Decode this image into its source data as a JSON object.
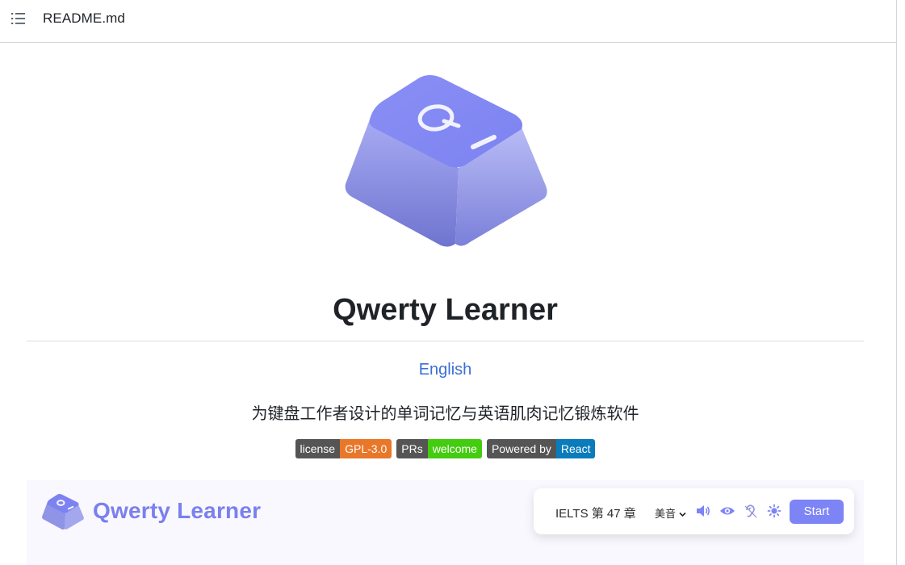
{
  "header": {
    "filename": "README.md",
    "toc_icon": "list-icon"
  },
  "readme": {
    "logo_icon": "keycap-q-logo",
    "title": "Qwerty Learner",
    "language_link": "English",
    "subtitle": "为键盘工作者设计的单词记忆与英语肌肉记忆锻炼软件",
    "badges": [
      {
        "label": "license",
        "value": "GPL-3.0",
        "color": "#e9772a"
      },
      {
        "label": "PRs",
        "value": "welcome",
        "color": "#44cc11"
      },
      {
        "label": "Powered by",
        "value": "React",
        "color": "#0a7bbb"
      }
    ]
  },
  "app_preview": {
    "app_name": "Qwerty Learner",
    "chapter_text": "IELTS 第 47 章",
    "accent_select": "美音",
    "icons": [
      "volume-icon",
      "eye-icon",
      "ear-icon",
      "sun-icon"
    ],
    "start_label": "Start",
    "accent_color": "#7d84f5"
  }
}
